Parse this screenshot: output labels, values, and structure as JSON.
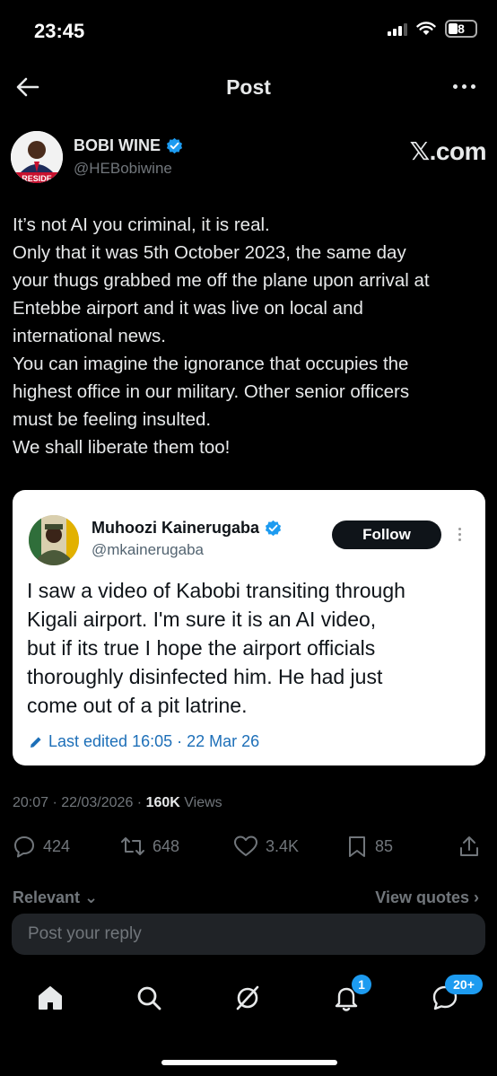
{
  "status_bar": {
    "time": "23:45",
    "battery": "8"
  },
  "header": {
    "title": "Post"
  },
  "author": {
    "name": "BOBI WINE",
    "handle": "@HEBobiwine",
    "avatar_text": "RESIDE",
    "watermark": "𝕏.com"
  },
  "post": {
    "lines": [
      "It’s not AI you criminal, it is real.",
      "Only that it was 5th October 2023, the same day",
      "your thugs grabbed me off the plane upon arrival at",
      "Entebbe airport and it was live on local and",
      "international news.",
      "You can imagine the ignorance that occupies the",
      "highest office in our military. Other senior officers",
      "must be feeling insulted.",
      "We shall liberate them too!"
    ]
  },
  "quote": {
    "name": "Muhoozi Kainerugaba",
    "handle": "@mkainerugaba",
    "follow_label": "Follow",
    "lines": [
      "I saw a video of Kabobi transiting through",
      "Kigali airport. I'm sure it is an AI video,",
      "but if its true I hope the airport officials",
      "thoroughly disinfected him. He had just",
      "come out of a pit latrine."
    ],
    "edited": "Last edited 16:05 · 22 Mar 26"
  },
  "meta": {
    "datetime": "20:07 · 22/03/2026 · ",
    "views_count": "160K",
    "views_label": " Views"
  },
  "actions": {
    "replies": "424",
    "reposts": "648",
    "likes": "3.4K",
    "bookmarks": "85"
  },
  "sort": {
    "left": "Relevant ⌄",
    "right": "View quotes ›"
  },
  "reply": {
    "placeholder": "Post your reply"
  },
  "tabs": {
    "notifications_badge": "1",
    "messages_badge": "20+"
  },
  "colors": {
    "accent": "#1d9bf0",
    "background": "#000000",
    "muted": "#71767b",
    "edited_link": "#1d6fb8"
  }
}
